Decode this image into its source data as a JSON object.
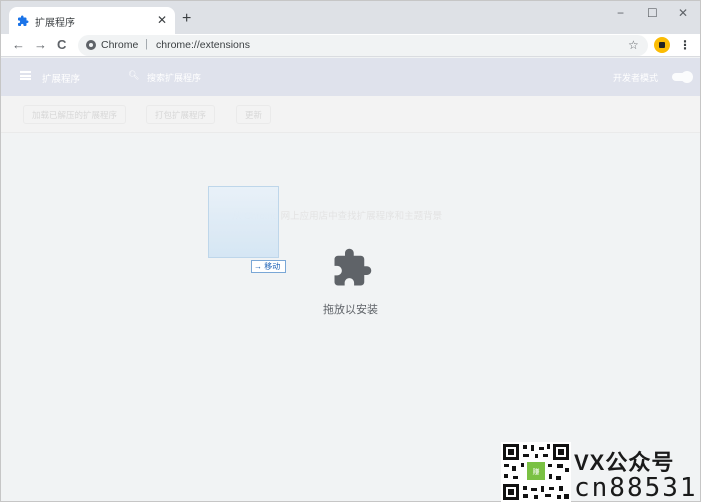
{
  "browser": {
    "tab_title": "扩展程序",
    "tab_close": "✕",
    "new_tab": "+",
    "minimize": "−",
    "maximize": "☐",
    "close": "✕",
    "back": "←",
    "forward": "→",
    "reload": "C",
    "url_label": "Chrome",
    "url_separator": "|",
    "url": "chrome://extensions",
    "bookmark": "☆",
    "menu": "⋮"
  },
  "extensions": {
    "title": "扩展程序",
    "search_placeholder": "搜索扩展程序",
    "dev_mode_label": "开发者模式",
    "dev_mode_on": true,
    "sub_buttons": [
      "加载已解压的扩展程序",
      "打包扩展程序",
      "更新"
    ],
    "hint": "从 Chrome 网上应用店中查找扩展程序和主题背景"
  },
  "drop_zone": {
    "label": "拖放以安装",
    "icon": "puzzle-icon"
  },
  "drag": {
    "tooltip": "→ 移动"
  },
  "watermark": {
    "line1": "VX公众号",
    "line2": "cn88531"
  },
  "colors": {
    "tab_strip": "#dee1e6",
    "page_bg": "#f1f3f4",
    "icon_gray": "#5f6368",
    "avatar": "#fbbc04",
    "chrome_blue": "#1a73e8"
  }
}
